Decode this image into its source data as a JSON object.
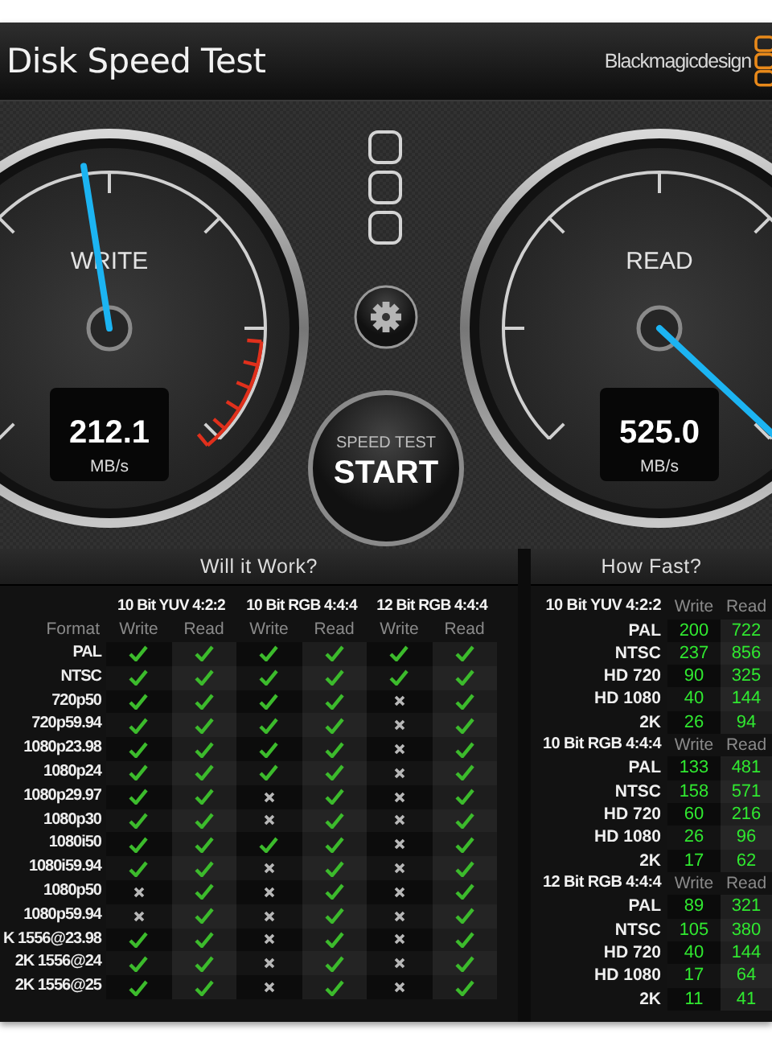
{
  "window": {
    "title": "Disk Speed Test",
    "brand": "Blackmagicdesign"
  },
  "gauges": [
    {
      "label": "WRITE",
      "value": "212.1",
      "unit": "MB/s",
      "redline": true
    },
    {
      "label": "READ",
      "value": "525.0",
      "unit": "MB/s",
      "redline": false
    }
  ],
  "start_button": {
    "caption": "SPEED TEST",
    "label": "START"
  },
  "will_it_work": {
    "title": "Will it Work?",
    "format_header": "Format",
    "groups": [
      {
        "name": "10 Bit YUV 4:2:2",
        "columns": [
          "Write",
          "Read"
        ]
      },
      {
        "name": "10 Bit RGB 4:4:4",
        "columns": [
          "Write",
          "Read"
        ]
      },
      {
        "name": "12 Bit RGB 4:4:4",
        "columns": [
          "Write",
          "Read"
        ]
      }
    ],
    "rows": [
      {
        "format": "PAL",
        "results": [
          true,
          true,
          true,
          true,
          true,
          true
        ]
      },
      {
        "format": "NTSC",
        "results": [
          true,
          true,
          true,
          true,
          true,
          true
        ]
      },
      {
        "format": "720p50",
        "results": [
          true,
          true,
          true,
          true,
          false,
          true
        ]
      },
      {
        "format": "720p59.94",
        "results": [
          true,
          true,
          true,
          true,
          false,
          true
        ]
      },
      {
        "format": "1080p23.98",
        "results": [
          true,
          true,
          true,
          true,
          false,
          true
        ]
      },
      {
        "format": "1080p24",
        "results": [
          true,
          true,
          true,
          true,
          false,
          true
        ]
      },
      {
        "format": "1080p29.97",
        "results": [
          true,
          true,
          false,
          true,
          false,
          true
        ]
      },
      {
        "format": "1080p30",
        "results": [
          true,
          true,
          false,
          true,
          false,
          true
        ]
      },
      {
        "format": "1080i50",
        "results": [
          true,
          true,
          true,
          true,
          false,
          true
        ]
      },
      {
        "format": "1080i59.94",
        "results": [
          true,
          true,
          false,
          true,
          false,
          true
        ]
      },
      {
        "format": "1080p50",
        "results": [
          false,
          true,
          false,
          true,
          false,
          true
        ]
      },
      {
        "format": "1080p59.94",
        "results": [
          false,
          true,
          false,
          true,
          false,
          true
        ]
      },
      {
        "format": "K 1556@23.98",
        "results": [
          true,
          true,
          false,
          true,
          false,
          true
        ]
      },
      {
        "format": "2K 1556@24",
        "results": [
          true,
          true,
          false,
          true,
          false,
          true
        ]
      },
      {
        "format": "2K 1556@25",
        "results": [
          true,
          true,
          false,
          true,
          false,
          true
        ]
      }
    ]
  },
  "how_fast": {
    "title": "How Fast?",
    "groups": [
      {
        "name": "10 Bit YUV 4:2:2",
        "columns": [
          "Write",
          "Read"
        ],
        "rows": [
          {
            "format": "PAL",
            "write": "200",
            "read": "722"
          },
          {
            "format": "NTSC",
            "write": "237",
            "read": "856"
          },
          {
            "format": "HD 720",
            "write": "90",
            "read": "325"
          },
          {
            "format": "HD 1080",
            "write": "40",
            "read": "144"
          },
          {
            "format": "2K",
            "write": "26",
            "read": "94"
          }
        ]
      },
      {
        "name": "10 Bit RGB 4:4:4",
        "columns": [
          "Write",
          "Read"
        ],
        "rows": [
          {
            "format": "PAL",
            "write": "133",
            "read": "481"
          },
          {
            "format": "NTSC",
            "write": "158",
            "read": "571"
          },
          {
            "format": "HD 720",
            "write": "60",
            "read": "216"
          },
          {
            "format": "HD 1080",
            "write": "26",
            "read": "96"
          },
          {
            "format": "2K",
            "write": "17",
            "read": "62"
          }
        ]
      },
      {
        "name": "12 Bit RGB 4:4:4",
        "columns": [
          "Write",
          "Read"
        ],
        "rows": [
          {
            "format": "PAL",
            "write": "89",
            "read": "321"
          },
          {
            "format": "NTSC",
            "write": "105",
            "read": "380"
          },
          {
            "format": "HD 720",
            "write": "40",
            "read": "144"
          },
          {
            "format": "HD 1080",
            "write": "17",
            "read": "64"
          },
          {
            "format": "2K",
            "write": "11",
            "read": "41"
          }
        ]
      }
    ]
  }
}
